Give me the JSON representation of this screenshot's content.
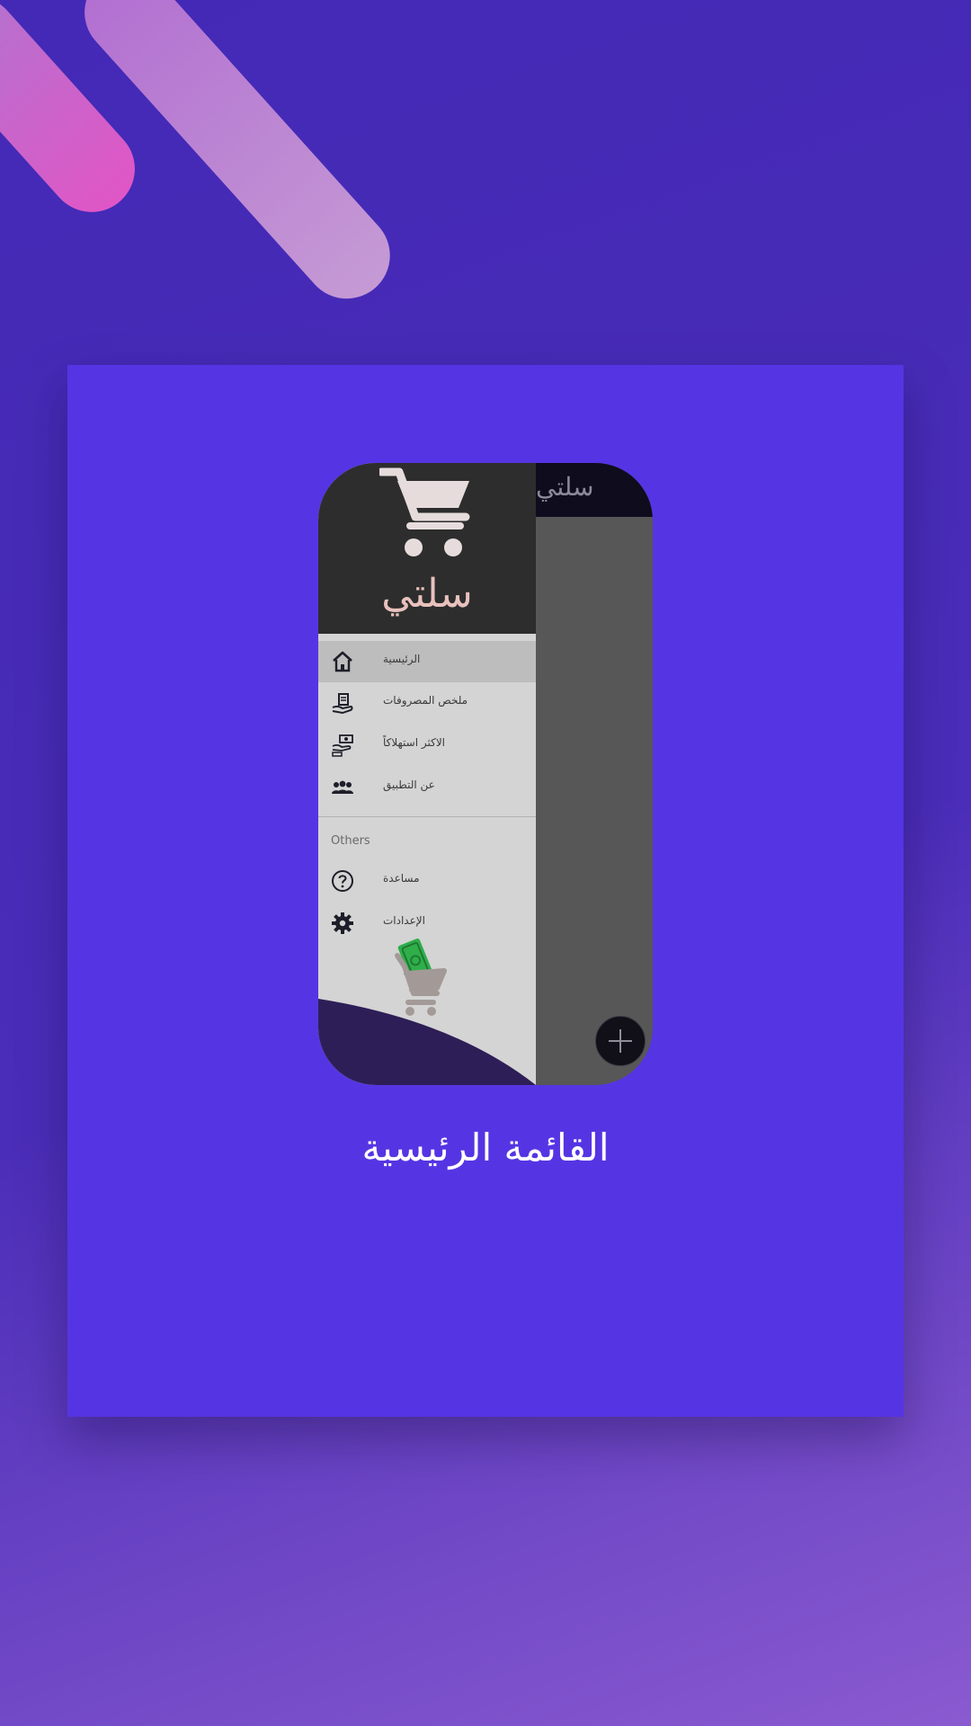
{
  "app": {
    "title": "سلتي",
    "brand_name": "سلتي"
  },
  "drawer": {
    "items": [
      {
        "label": "الرئيسية",
        "icon": "home-icon",
        "active": true
      },
      {
        "label": "ملخص المصروفات",
        "icon": "hand-receipt-icon",
        "active": false
      },
      {
        "label": "الاكثر استهلاكاً",
        "icon": "money-hand-icon",
        "active": false
      },
      {
        "label": "عن التطبيق",
        "icon": "group-icon",
        "active": false
      }
    ],
    "section_label": "Others",
    "other_items": [
      {
        "label": "مساعدة",
        "icon": "help-icon"
      },
      {
        "label": "الإعدادات",
        "icon": "gear-icon"
      }
    ]
  },
  "caption": "القائمة الرئيسية",
  "colors": {
    "background": "#4329b6",
    "card": "#5535e3",
    "drawer_header": "#2d2d2d",
    "drawer_body": "#d4d4d4",
    "wave": "#2e1e57",
    "brand_text": "#e8c1bd"
  }
}
